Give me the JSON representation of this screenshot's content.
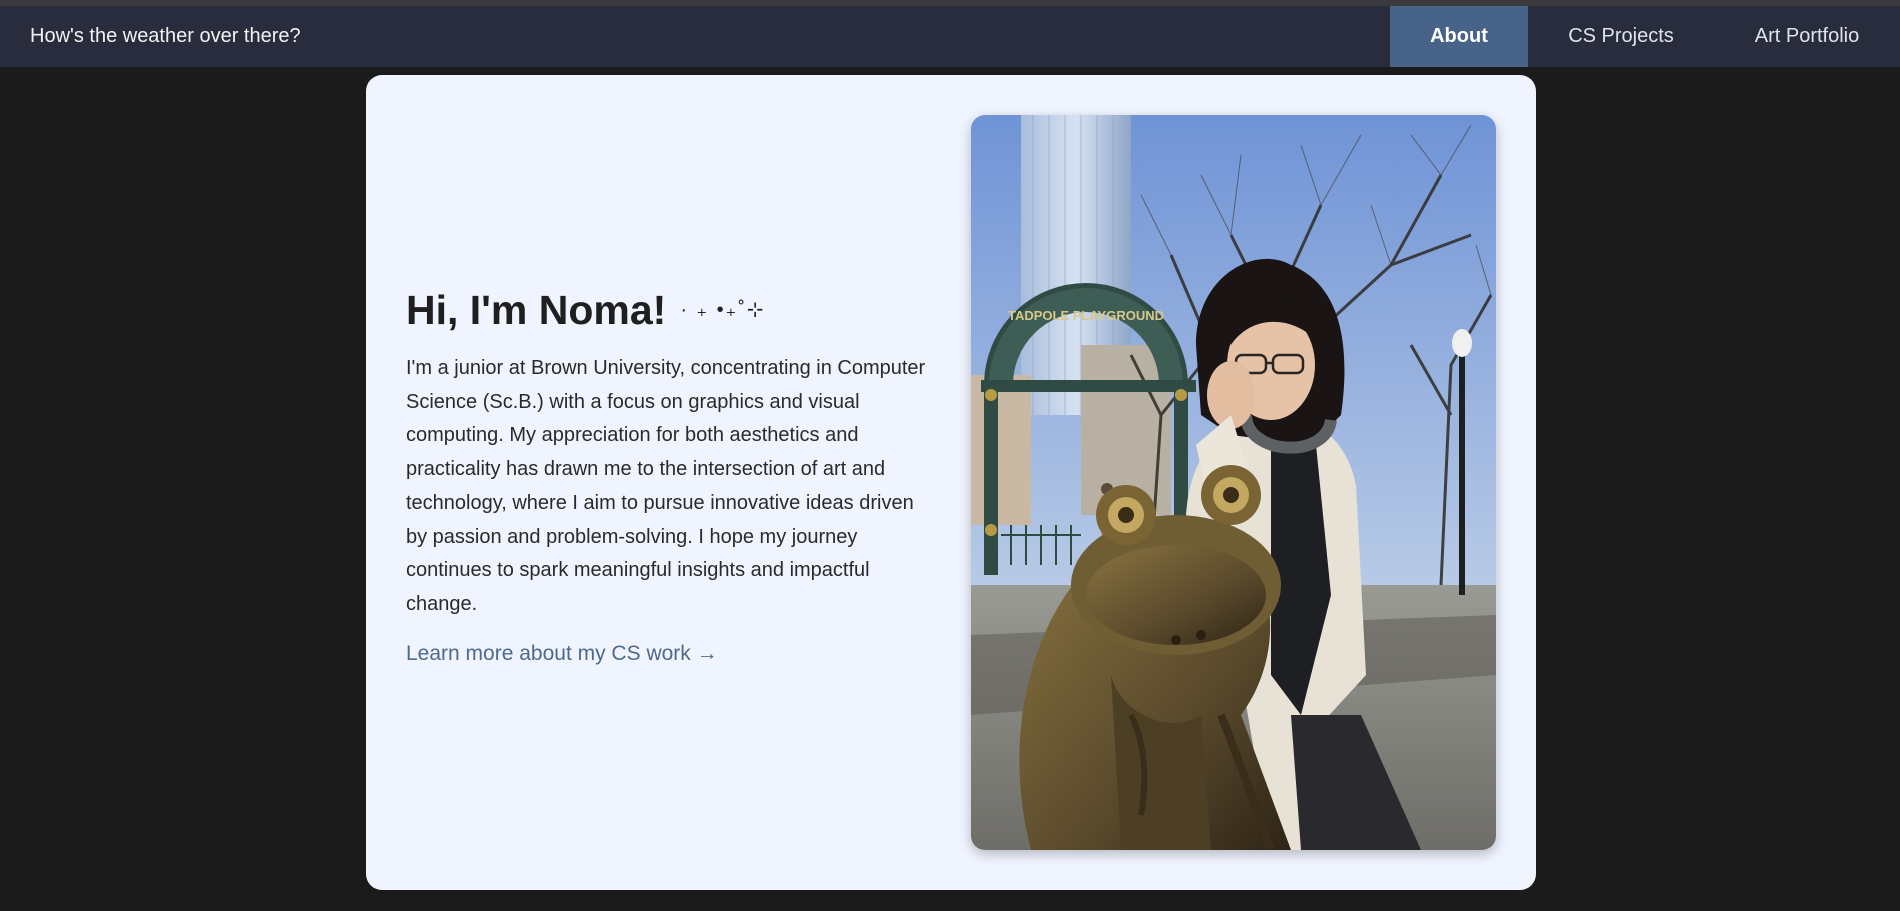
{
  "header": {
    "site_title": "How's the weather over there?",
    "nav": [
      {
        "label": "About",
        "active": true
      },
      {
        "label": "CS Projects",
        "active": false
      },
      {
        "label": "Art Portfolio",
        "active": false
      }
    ]
  },
  "intro": {
    "greeting": "Hi, I'm Noma!",
    "sparkle": "· ₊ •₊˚⊹",
    "bio": "I'm a junior at Brown University, concentrating in Computer Science (Sc.B.) with a focus on graphics and visual computing. My appreciation for both aesthetics and practicality has drawn me to the intersection of art and technology, where I aim to pursue innovative ideas driven by passion and problem-solving. I hope my journey continues to spark meaningful insights and impactful change.",
    "link_text": "Learn more about my CS work →"
  },
  "photo": {
    "sign_text": "TADPOLE PLAYGROUND"
  },
  "colors": {
    "background": "#1b1b1b",
    "navbar": "#282c3c",
    "nav_active": "#476488",
    "card": "#f0f4ff",
    "link": "#4d6a8d"
  }
}
